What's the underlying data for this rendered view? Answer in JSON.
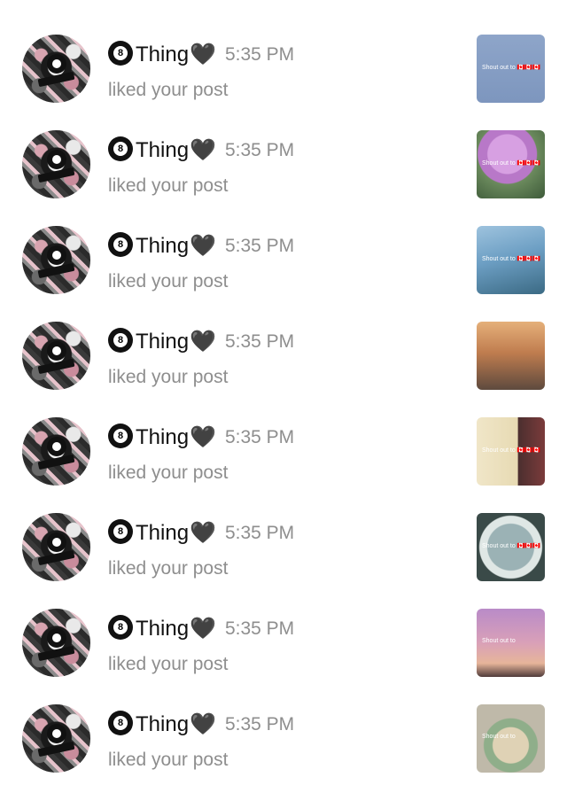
{
  "notifications": [
    {
      "flag": "8",
      "name": "Thing",
      "heart": "🖤",
      "time": "5:35 PM",
      "action": "liked your post",
      "thumb": {
        "caption": "Shout out to",
        "flags": "🇨🇦🇨🇦🇨🇦",
        "bg": "linear-gradient(180deg,#8ea5c9 0%,#7d96be 100%)"
      }
    },
    {
      "flag": "8",
      "name": "Thing",
      "heart": "🖤",
      "time": "5:35 PM",
      "action": "liked your post",
      "thumb": {
        "caption": "Shout out to",
        "flags": "🇨🇦🇨🇦🇨🇦",
        "bg": "radial-gradient(circle at 45% 35%,#d7a0e2 0 22px,#b878c8 23px 33px,#6b8a5d 34px,#3d5a39 100%)"
      }
    },
    {
      "flag": "8",
      "name": "Thing",
      "heart": "🖤",
      "time": "5:35 PM",
      "action": "liked your post",
      "thumb": {
        "caption": "Shout out to",
        "flags": "🇨🇦🇨🇦🇨🇦",
        "bg": "linear-gradient(165deg,#9ec3de 0%,#6d9fc4 45%,#3b6a84 100%)"
      }
    },
    {
      "flag": "8",
      "name": "Thing",
      "heart": "🖤",
      "time": "5:35 PM",
      "action": "liked your post",
      "thumb": {
        "caption": "",
        "flags": "",
        "bg": "linear-gradient(180deg,#e5b07a 0%,#c07d4f 45%,#5e4a3e 100%)"
      }
    },
    {
      "flag": "8",
      "name": "Thing",
      "heart": "🖤",
      "time": "5:35 PM",
      "action": "liked your post",
      "thumb": {
        "caption": "Shout out to",
        "flags": "🇨🇦🇨🇦🇨🇦",
        "bg": "linear-gradient(90deg,#f0e6c8 0%,#e7dab3 60%,#4b2f2f 61%,#7b3b3b 100%)"
      }
    },
    {
      "flag": "8",
      "name": "Thing",
      "heart": "🖤",
      "time": "5:35 PM",
      "action": "liked your post",
      "thumb": {
        "caption": "Shout out to",
        "flags": "🇨🇦🇨🇦🇨🇦",
        "bg": "radial-gradient(circle at 50% 50%,#9bb2b5 0 26px,#dfe7e5 27px 35px,#3a4a48 36px)"
      }
    },
    {
      "flag": "8",
      "name": "Thing",
      "heart": "🖤",
      "time": "5:35 PM",
      "action": "liked your post",
      "thumb": {
        "caption": "Shout out to",
        "flags": "",
        "bg": "linear-gradient(180deg,#b98bc8 0%,#d9a0b8 50%,#e6b59a 80%,#503b3a 100%)"
      }
    },
    {
      "flag": "8",
      "name": "Thing",
      "heart": "🖤",
      "time": "5:35 PM",
      "action": "liked your post",
      "thumb": {
        "caption": "Shout out to",
        "flags": "",
        "bg": "radial-gradient(circle at 50% 60%,#dfd2b5 0 20px,#8fae8a 21px 30px,#bfb9a9 31px)"
      }
    }
  ],
  "colors": {
    "text_primary": "#111111",
    "text_secondary": "#8e8e8e",
    "background": "#ffffff"
  },
  "icons": {
    "eight_ball": "eight-ball-icon",
    "heart": "black-heart-icon"
  }
}
